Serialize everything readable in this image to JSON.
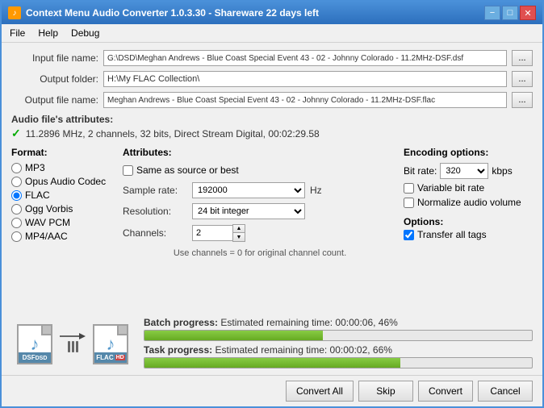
{
  "window": {
    "title": "Context Menu Audio Converter 1.0.3.30 - Shareware 22 days left",
    "icon": "♪"
  },
  "title_controls": {
    "minimize": "−",
    "maximize": "□",
    "close": "✕"
  },
  "menu": {
    "items": [
      "File",
      "Help",
      "Debug"
    ]
  },
  "fields": {
    "input_label": "Input file name:",
    "input_value": "G:\\DSD\\Meghan Andrews - Blue Coast Special Event 43 - 02 - Johnny Colorado - 11.2MHz-DSF.dsf",
    "output_folder_label": "Output folder:",
    "output_folder_value": "H:\\My FLAC Collection\\",
    "output_file_label": "Output file name:",
    "output_file_value": "Meghan Andrews - Blue Coast Special Event 43 - 02 - Johnny Colorado - 11.2MHz-DSF.flac"
  },
  "audio_attrs": {
    "title": "Audio file's attributes:",
    "value": "11.2896 MHz, 2 channels, 32 bits, Direct Stream Digital, 00:02:29.58"
  },
  "format": {
    "title": "Format:",
    "options": [
      {
        "label": "MP3",
        "selected": false
      },
      {
        "label": "Opus Audio Codec",
        "selected": false
      },
      {
        "label": "FLAC",
        "selected": true
      },
      {
        "label": "Ogg Vorbis",
        "selected": false
      },
      {
        "label": "WAV PCM",
        "selected": false
      },
      {
        "label": "MP4/AAC",
        "selected": false
      }
    ]
  },
  "attributes": {
    "title": "Attributes:",
    "same_as_source_label": "Same as source or best",
    "sample_rate_label": "Sample rate:",
    "sample_rate_value": "192000",
    "sample_rate_unit": "Hz",
    "resolution_label": "Resolution:",
    "resolution_value": "24 bit integer",
    "channels_label": "Channels:",
    "channels_value": "2",
    "hint": "Use channels = 0 for original channel count."
  },
  "encoding": {
    "title": "Encoding options:",
    "bitrate_label": "Bit rate:",
    "bitrate_value": "320",
    "bitrate_unit": "kbps",
    "variable_label": "Variable bit rate",
    "normalize_label": "Normalize audio volume",
    "options_title": "Options:",
    "transfer_tags_label": "Transfer all tags",
    "transfer_tags_checked": true
  },
  "progress": {
    "batch_label": "Batch progress:",
    "batch_detail": "Estimated remaining time: 00:00:06, 46%",
    "batch_percent": 46,
    "task_label": "Task progress:",
    "task_detail": "Estimated remaining time: 00:00:02, 66%",
    "task_percent": 66
  },
  "buttons": {
    "convert_all": "Convert All",
    "skip": "Skip",
    "convert": "Convert",
    "cancel": "Cancel"
  },
  "file_icons": {
    "source_label1": "DSF",
    "source_label2": "DSD",
    "target_label1": "FLAC",
    "arrow": "→"
  }
}
